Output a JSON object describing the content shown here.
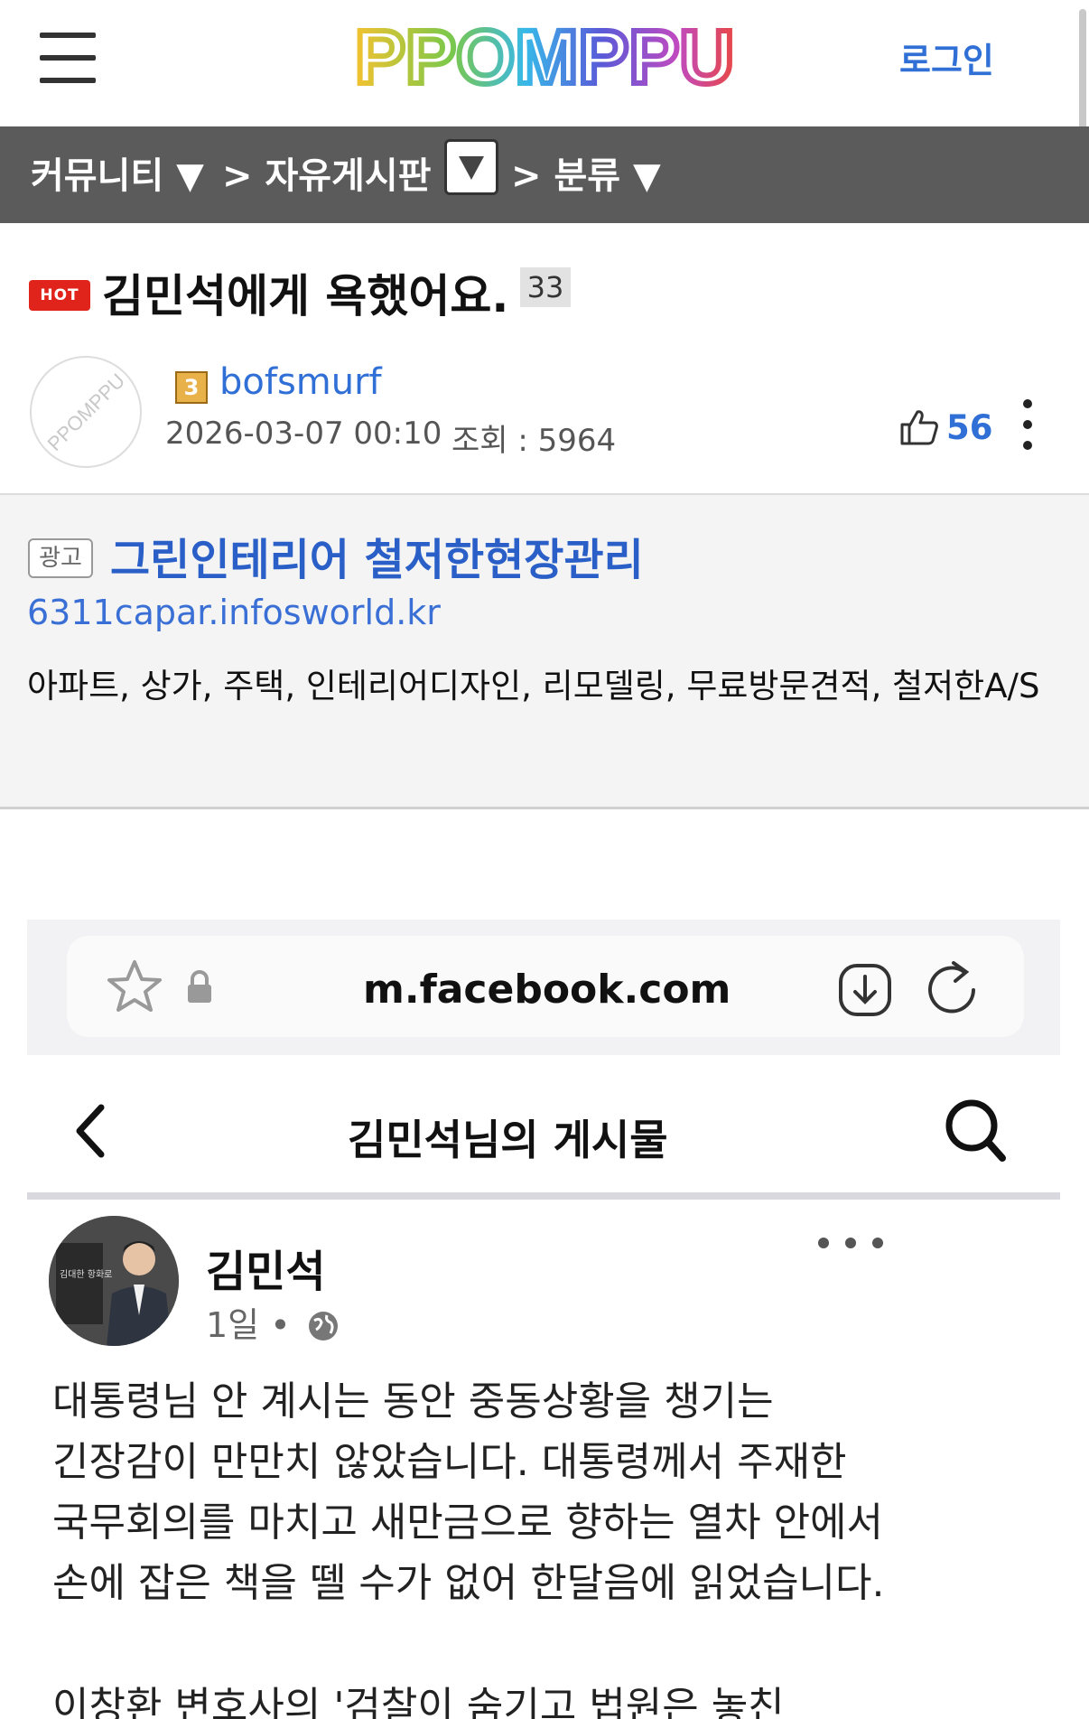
{
  "header": {
    "logo_text": "PPOMPPU",
    "login_label": "로그인"
  },
  "nav": {
    "community": "커뮤니티 ▼",
    "board": "> 자유게시판",
    "category": "> 분류 ▼"
  },
  "post": {
    "hot_badge": "HOT",
    "title": "김민석에게 욕했어요.",
    "comment_count": "33",
    "avatar_text": "PPOMPPU",
    "level": "3",
    "author": "bofsmurf",
    "datetime": "2026-03-07 00:10",
    "views_label": "조회 : 5964",
    "likes": "56"
  },
  "ad": {
    "badge": "광고",
    "title": "그린인테리어 철저한현장관리",
    "url": "6311capar.infosworld.kr",
    "description": "아파트, 상가, 주택, 인테리어디자인, 리모델링, 무료방문견적, 철저한A/S"
  },
  "screenshot": {
    "url": "m.facebook.com",
    "page_title": "김민석님의 게시물",
    "avatar_sign": "김대한 항화로",
    "name": "김민석",
    "time": "1일 •",
    "text_lines": [
      "대통령님 안 계시는 동안 중동상황을 챙기는",
      "긴장감이 만만치 않았습니다. 대통령께서 주재한",
      "국무회의를 마치고 새만금으로 향하는 열차 안에서",
      "손에 잡은 책을 뗄 수가 없어 한달음에 읽었습니다."
    ],
    "text_line_next": "이창환 변호사의 '검찰이 숨기고 법원은 놓친"
  },
  "colors": {
    "link_blue": "#2f6fd6",
    "nav_bg": "#5b5b5b",
    "hot_red": "#e0241c"
  },
  "icons": [
    "hamburger-icon",
    "dropdown-arrow-icon",
    "thumbs-up-icon",
    "more-vert-icon",
    "star-icon",
    "lock-icon",
    "download-icon",
    "reload-icon",
    "back-icon",
    "search-icon",
    "more-horiz-icon",
    "globe-icon"
  ]
}
